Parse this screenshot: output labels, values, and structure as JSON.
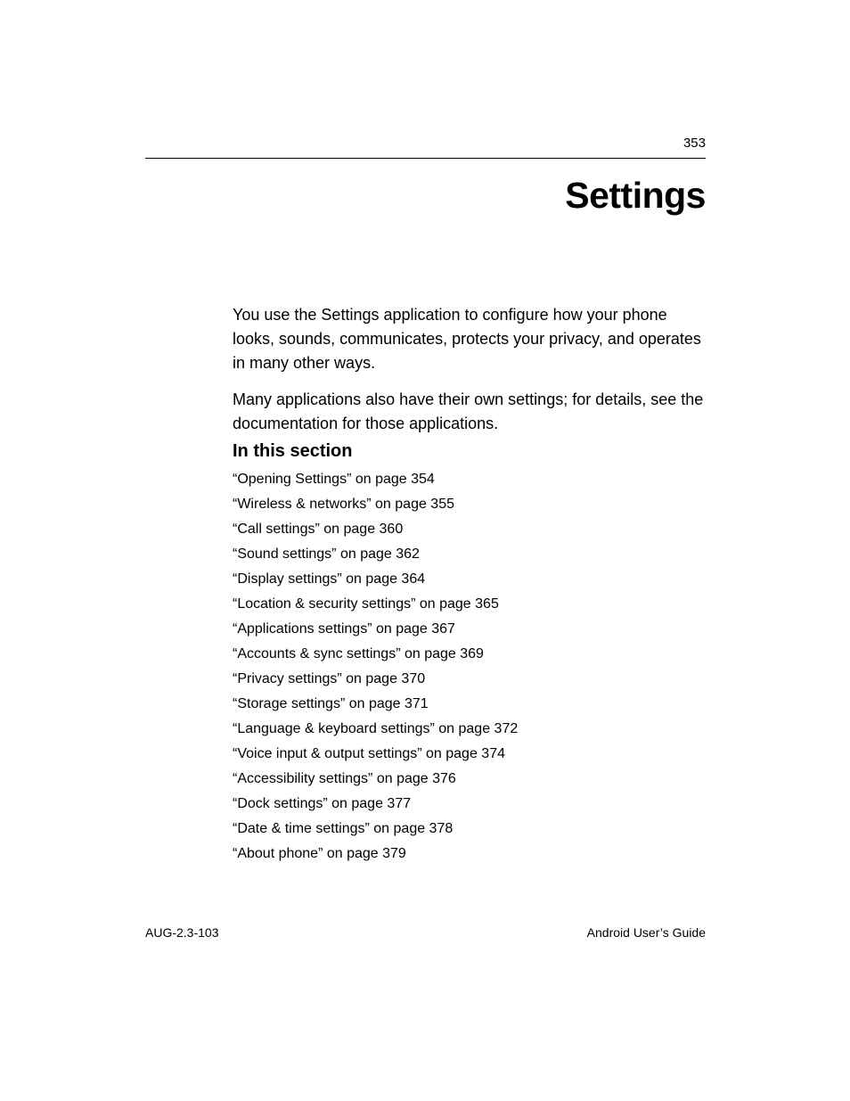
{
  "page_number": "353",
  "chapter_title": "Settings",
  "paragraphs": [
    "You use the Settings application to configure how your phone looks, sounds, communicates, protects your privacy, and operates in many other ways.",
    "Many applications also have their own settings; for details, see the documentation for those applications."
  ],
  "section_heading": "In this section",
  "toc": [
    "“Opening Settings” on page 354",
    "“Wireless & networks” on page 355",
    "“Call settings” on page 360",
    "“Sound settings” on page 362",
    "“Display settings” on page 364",
    "“Location & security settings” on page 365",
    "“Applications settings” on page 367",
    "“Accounts & sync settings” on page 369",
    "“Privacy settings” on page 370",
    "“Storage settings” on page 371",
    "“Language & keyboard settings” on page 372",
    "“Voice input & output settings” on page 374",
    "“Accessibility settings” on page 376",
    "“Dock settings” on page 377",
    "“Date & time settings” on page 378",
    "“About phone” on page 379"
  ],
  "footer_left": "AUG-2.3-103",
  "footer_right": "Android User’s Guide"
}
